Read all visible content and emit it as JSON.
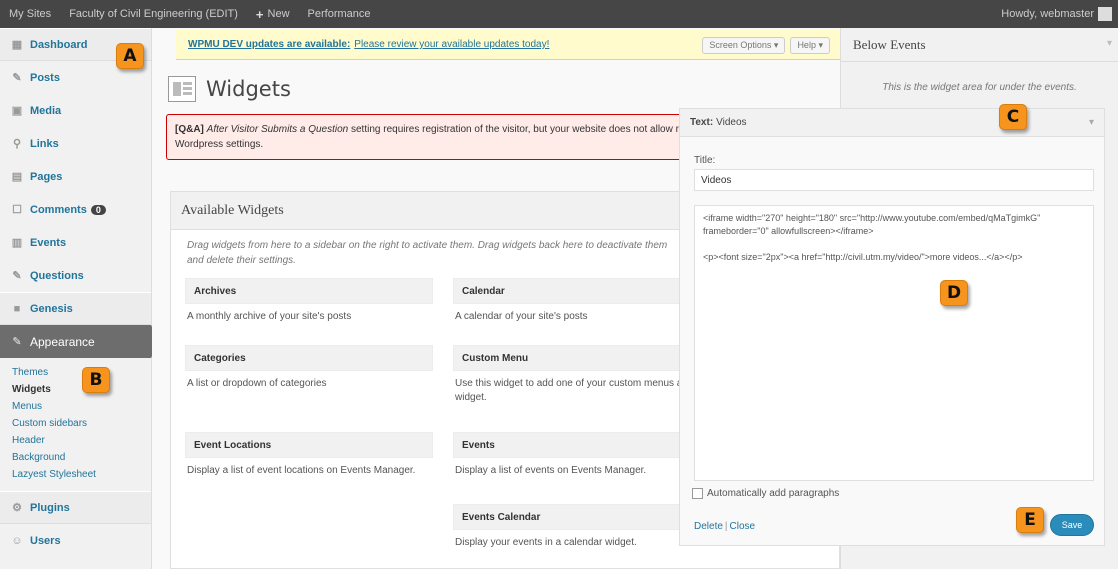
{
  "adminbar": {
    "my_sites": "My Sites",
    "site_name": "Faculty of Civil Engineering (EDIT)",
    "new_label": "New",
    "performance": "Performance",
    "howdy": "Howdy, webmaster"
  },
  "sidebar": {
    "items": [
      {
        "label": "Dashboard",
        "icon": "dashboard-icon"
      },
      {
        "label": "Posts",
        "icon": "pin-icon"
      },
      {
        "label": "Media",
        "icon": "media-icon"
      },
      {
        "label": "Links",
        "icon": "links-icon"
      },
      {
        "label": "Pages",
        "icon": "pages-icon"
      },
      {
        "label": "Comments",
        "icon": "comments-icon",
        "badge": "0"
      },
      {
        "label": "Events",
        "icon": "events-icon"
      },
      {
        "label": "Questions",
        "icon": "pin-icon"
      },
      {
        "label": "Genesis",
        "icon": "genesis-icon"
      },
      {
        "label": "Appearance",
        "icon": "appearance-icon"
      }
    ],
    "submenu": [
      "Themes",
      "Widgets",
      "Menus",
      "Custom sidebars",
      "Header",
      "Background",
      "Lazyest Stylesheet"
    ],
    "after": [
      {
        "label": "Plugins",
        "icon": "plugins-icon"
      },
      {
        "label": "Users",
        "icon": "users-icon"
      }
    ]
  },
  "notice": {
    "strong": "WPMU DEV updates are available:",
    "link": "Please review your available updates today!",
    "screen_options": "Screen Options",
    "help": "Help"
  },
  "page": {
    "title": "Widgets"
  },
  "error": {
    "tag": "[Q&A]",
    "italic": "After Visitor Submits a Question",
    "rest": "setting requires registration of the visitor, but your website does not allow registration. Please change your",
    "line2": "Wordpress settings."
  },
  "available": {
    "heading": "Available Widgets",
    "desc": "Drag widgets from here to a sidebar on the right to activate them. Drag widgets back here to deactivate them and delete their settings.",
    "widgets": [
      {
        "title": "Archives",
        "desc": "A monthly archive of your site's posts"
      },
      {
        "title": "Calendar",
        "desc": "A calendar of your site's posts"
      },
      {
        "title": "Categories",
        "desc": "A list or dropdown of categories"
      },
      {
        "title": "Custom Menu",
        "desc": "Use this widget to add one of your custom menus as a widget."
      },
      {
        "title": "Event Locations",
        "desc": "Display a list of event locations on Events Manager."
      },
      {
        "title": "Events",
        "desc": "Display a list of events on Events Manager."
      },
      {
        "title": "Events Calendar",
        "desc": "Display your events in a calendar widget."
      }
    ]
  },
  "right": {
    "heading": "Below Events",
    "desc": "This is the widget area for under the events."
  },
  "edit": {
    "type": "Text:",
    "name": "Videos",
    "title_label": "Title:",
    "title_value": "Videos",
    "content": "<iframe width=\"270\" height=\"180\" src=\"http://www.youtube.com/embed/qMaTgimkG\" frameborder=\"0\" allowfullscreen></iframe>\n\n<p><font size=\"2px\"><a href=\"http://civil.utm.my/video/\">more videos...</a></p>",
    "autop": "Automatically add paragraphs",
    "delete": "Delete",
    "close": "Close",
    "save": "Save"
  },
  "callouts": [
    "A",
    "B",
    "C",
    "D",
    "E"
  ]
}
